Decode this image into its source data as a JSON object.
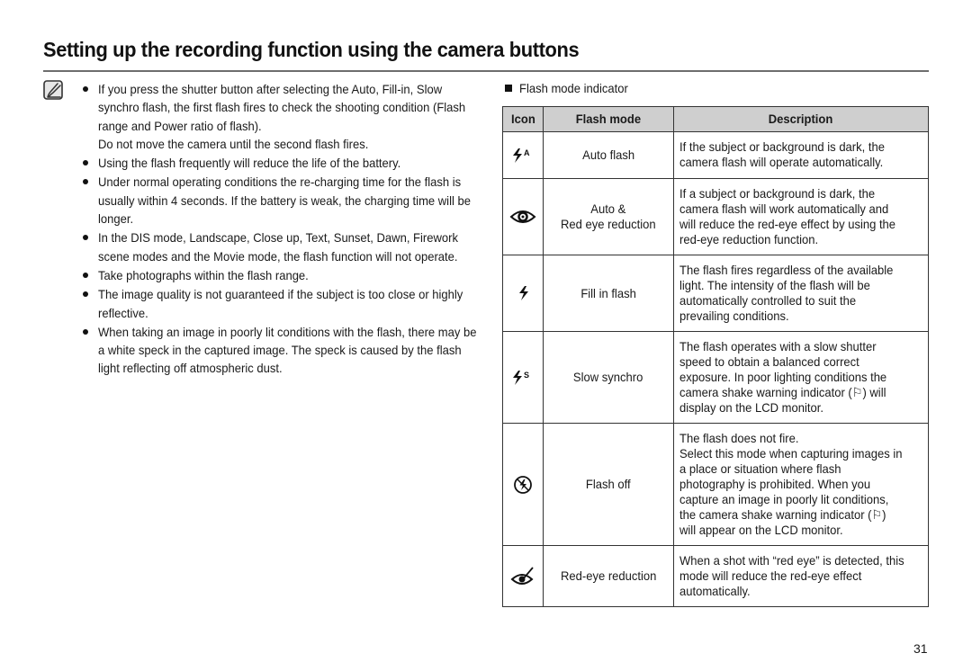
{
  "page": {
    "title": "Setting up the recording function using the camera buttons",
    "page_number": "31"
  },
  "notes": {
    "icon": "note-pencil-icon",
    "items": [
      {
        "text": "If you press the shutter button after selecting the Auto, Fill-in, Slow synchro flash, the first flash fires to check the shooting condition (Flash range and Power ratio of flash).",
        "subtext": "Do not move the camera until the second flash fires."
      },
      {
        "text": "Using the flash frequently will reduce the life of the battery."
      },
      {
        "text": "Under normal operating conditions the re-charging time for the flash is usually within 4 seconds. If the battery is weak, the charging time will be longer."
      },
      {
        "text": "In the DIS mode, Landscape, Close up, Text, Sunset, Dawn, Firework scene modes and the Movie mode, the flash function will not operate."
      },
      {
        "text": "Take photographs within the flash range."
      },
      {
        "text": "The image quality is not guaranteed if the subject is too close or highly reflective."
      },
      {
        "text": "When taking an image in poorly lit conditions with the flash, there may be a white speck in the captured image. The speck is caused by the flash light reflecting off atmospheric dust."
      }
    ]
  },
  "flash_table": {
    "section_label": "Flash mode indicator",
    "headers": {
      "icon": "Icon",
      "mode": "Flash mode",
      "description": "Description"
    },
    "rows": [
      {
        "icon": "auto-flash-icon",
        "mode": "Auto flash",
        "description": "If the subject or background is dark, the camera flash will operate automatically."
      },
      {
        "icon": "red-eye-auto-icon",
        "mode": "Auto &\nRed eye reduction",
        "description": "If a subject or background is dark, the camera flash will work automatically and will reduce the red-eye effect by using the red-eye reduction function."
      },
      {
        "icon": "fill-flash-icon",
        "mode": "Fill in flash",
        "description": "The flash fires regardless of the available light. The intensity of the flash will be automatically controlled to suit the prevailing conditions."
      },
      {
        "icon": "slow-synchro-icon",
        "mode": "Slow synchro",
        "description": "The flash operates with a slow shutter speed to obtain a balanced correct exposure. In poor lighting conditions the camera shake warning indicator (⚐) will display on the LCD monitor."
      },
      {
        "icon": "flash-off-icon",
        "mode": "Flash off",
        "description": "The flash does not fire.\nSelect this mode when capturing images in a place or situation where flash photography is prohibited. When you capture an image in poorly lit conditions, the camera shake warning indicator (⚐) will appear on the LCD monitor."
      },
      {
        "icon": "red-eye-fix-icon",
        "mode": "Red-eye reduction",
        "description": "When a shot with “red eye” is detected, this mode will reduce the red-eye effect automatically."
      }
    ]
  }
}
